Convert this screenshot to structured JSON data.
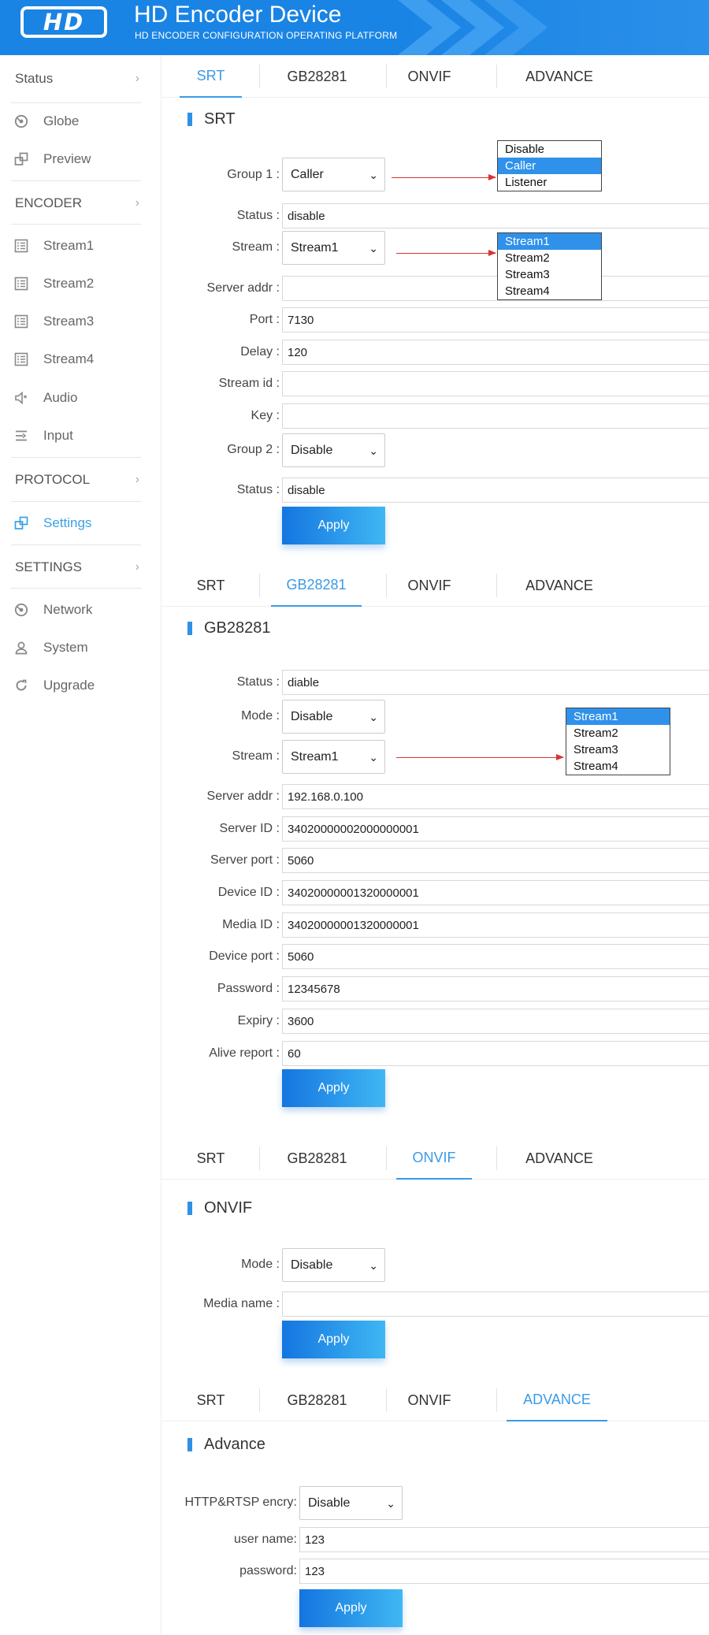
{
  "header": {
    "logo_text": "HD",
    "title": "HD Encoder Device",
    "subtitle": "HD ENCODER CONFIGURATION OPERATING PLATFORM"
  },
  "sidebar": {
    "sections": [
      {
        "label": "Status",
        "items": [
          {
            "label": "Globe",
            "icon": "globe-icon"
          },
          {
            "label": "Preview",
            "icon": "preview-icon"
          }
        ]
      },
      {
        "label": "ENCODER",
        "items": [
          {
            "label": "Stream1",
            "icon": "stream-icon"
          },
          {
            "label": "Stream2",
            "icon": "stream-icon"
          },
          {
            "label": "Stream3",
            "icon": "stream-icon"
          },
          {
            "label": "Stream4",
            "icon": "stream-icon"
          },
          {
            "label": "Audio",
            "icon": "audio-icon"
          },
          {
            "label": "Input",
            "icon": "input-icon"
          }
        ]
      },
      {
        "label": "PROTOCOL",
        "items": [
          {
            "label": "Settings",
            "icon": "settings-icon",
            "active": true
          }
        ]
      },
      {
        "label": "SETTINGS",
        "items": [
          {
            "label": "Network",
            "icon": "network-icon"
          },
          {
            "label": "System",
            "icon": "user-icon"
          },
          {
            "label": "Upgrade",
            "icon": "refresh-icon"
          }
        ]
      }
    ]
  },
  "tabs": [
    "SRT",
    "GB28281",
    "ONVIF",
    "ADVANCE"
  ],
  "srt": {
    "title": "SRT",
    "group1_label": "Group 1 :",
    "group1_value": "Caller",
    "status_label": "Status :",
    "status_value": "disable",
    "stream_label": "Stream :",
    "stream_value": "Stream1",
    "server_addr_label": "Server addr :",
    "server_addr_value": "",
    "port_label": "Port :",
    "port_value": "7130",
    "delay_label": "Delay :",
    "delay_value": "120",
    "stream_id_label": "Stream id :",
    "stream_id_value": "",
    "key_label": "Key :",
    "key_value": "",
    "group2_label": "Group 2 :",
    "group2_value": "Disable",
    "status2_label": "Status :",
    "status2_value": "disable",
    "apply_label": "Apply",
    "group_options": [
      "Disable",
      "Caller",
      "Listener"
    ],
    "stream_options": [
      "Stream1",
      "Stream2",
      "Stream3",
      "Stream4"
    ]
  },
  "gb": {
    "title": "GB28281",
    "status_label": "Status :",
    "status_value": "diable",
    "mode_label": "Mode :",
    "mode_value": "Disable",
    "stream_label": "Stream :",
    "stream_value": "Stream1",
    "server_addr_label": "Server addr :",
    "server_addr_value": "192.168.0.100",
    "server_id_label": "Server ID :",
    "server_id_value": "34020000002000000001",
    "server_port_label": "Server port :",
    "server_port_value": "5060",
    "device_id_label": "Device ID :",
    "device_id_value": "34020000001320000001",
    "media_id_label": "Media ID :",
    "media_id_value": "34020000001320000001",
    "device_port_label": "Device port :",
    "device_port_value": "5060",
    "password_label": "Password :",
    "password_value": "12345678",
    "expiry_label": "Expiry :",
    "expiry_value": "3600",
    "alive_label": "Alive report :",
    "alive_value": "60",
    "apply_label": "Apply",
    "stream_options": [
      "Stream1",
      "Stream2",
      "Stream3",
      "Stream4"
    ]
  },
  "onvif": {
    "title": "ONVIF",
    "mode_label": "Mode :",
    "mode_value": "Disable",
    "media_name_label": "Media name :",
    "media_name_value": "",
    "apply_label": "Apply"
  },
  "advance": {
    "title": "Advance",
    "encry_label": "HTTP&RTSP encry:",
    "encry_value": "Disable",
    "user_label": "user name:",
    "user_value": "123",
    "pass_label": "password:",
    "pass_value": "123",
    "apply_label": "Apply"
  },
  "colors": {
    "header_bg": "#1a84e4",
    "accent": "#3b9ae6",
    "annotation_arrow": "#d93434"
  }
}
